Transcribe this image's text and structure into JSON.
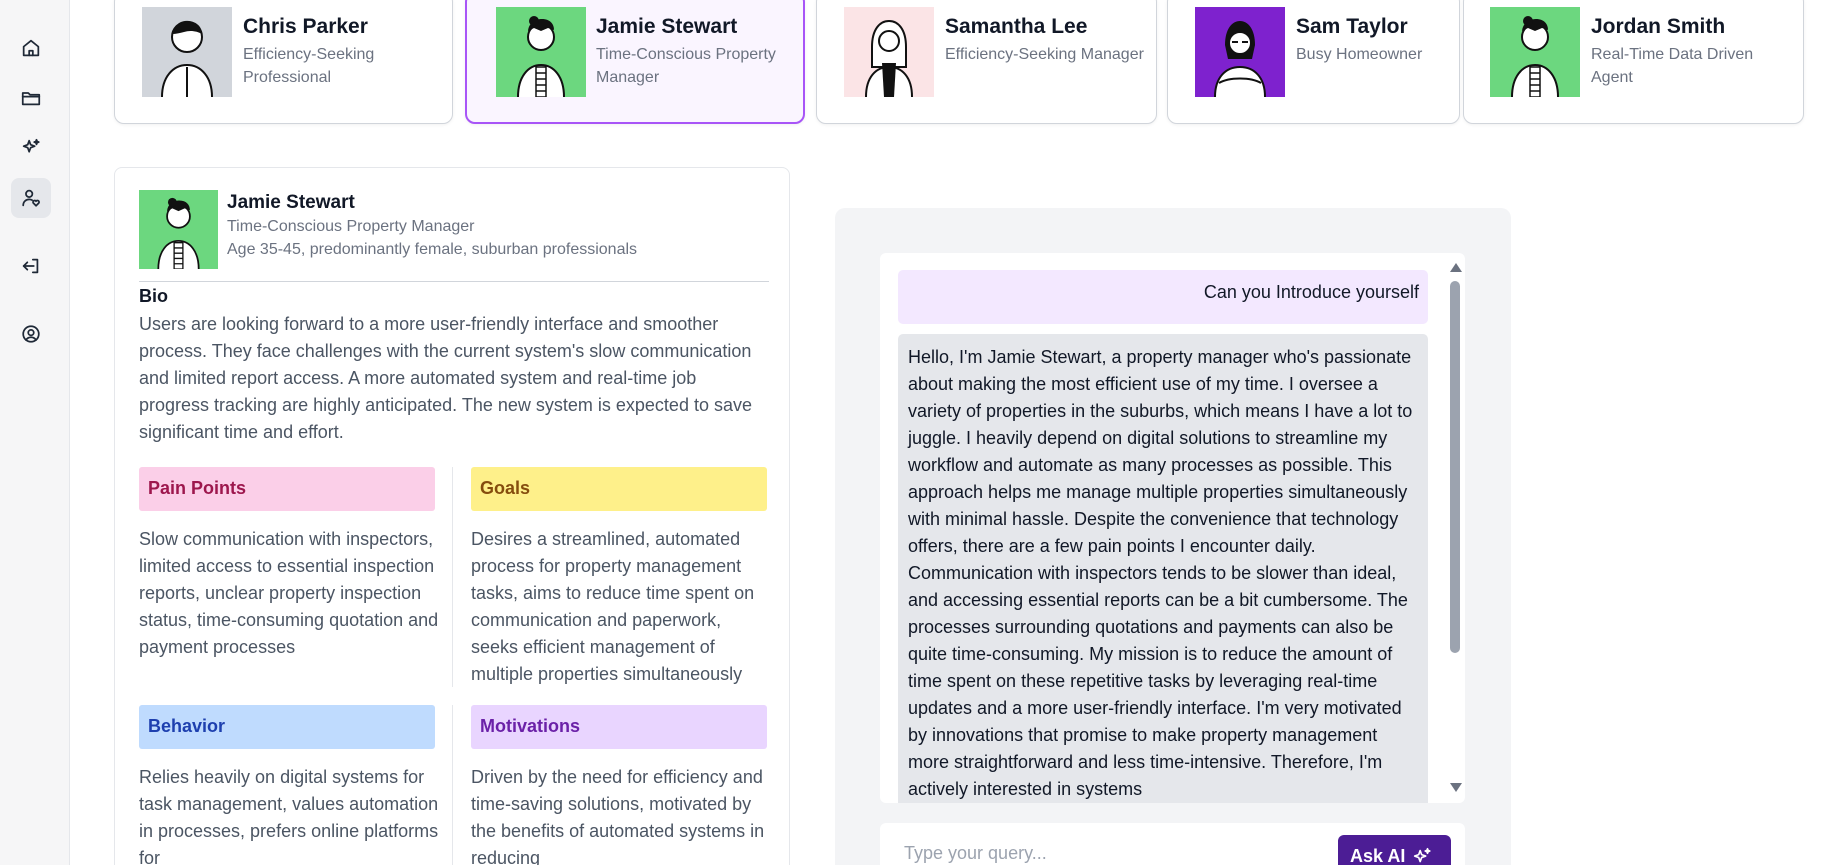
{
  "sidebar": {
    "items": [
      {
        "icon": "home-icon"
      },
      {
        "icon": "folder-icon"
      },
      {
        "icon": "sparkles-icon"
      },
      {
        "icon": "user-heart-icon",
        "active": true
      },
      {
        "icon": "logout-icon"
      },
      {
        "icon": "account-circle-icon"
      }
    ]
  },
  "personas": [
    {
      "name": "Chris Parker",
      "role": "Efficiency-Seeking Professional",
      "avatar_bg": "#d1d5db"
    },
    {
      "name": "Jamie Stewart",
      "role": "Time-Conscious Property Manager",
      "avatar_bg": "#6cd77f",
      "selected": true
    },
    {
      "name": "Samantha Lee",
      "role": "Efficiency-Seeking Manager",
      "avatar_bg": "#fbe4e6"
    },
    {
      "name": "Sam Taylor",
      "role": "Busy Homeowner",
      "avatar_bg": "#7e22ce"
    },
    {
      "name": "Jordan Smith",
      "role": "Real-Time Data Driven Agent",
      "avatar_bg": "#6cd77f"
    }
  ],
  "detail": {
    "name": "Jamie Stewart",
    "role": "Time-Conscious Property Manager",
    "demographic": "Age 35-45, predominantly female, suburban professionals",
    "bio_title": "Bio",
    "bio": "Users are looking forward to a more user-friendly interface and smoother process. They face challenges with the current system's slow communication and limited report access. A more automated system and real-time job progress tracking are highly anticipated. The new system is expected to save significant time and effort.",
    "pain_points": {
      "title": "Pain Points",
      "text": "Slow communication with inspectors, limited access to essential inspection reports, unclear property inspection status, time-consuming quotation and payment processes",
      "bg": "#fbcfe8",
      "color": "#9d174d"
    },
    "goals": {
      "title": "Goals",
      "text": "Desires a streamlined, automated process for property management tasks, aims to reduce time spent on communication and paperwork, seeks efficient management of multiple properties simultaneously",
      "bg": "#fef08a",
      "color": "#854d0e"
    },
    "behavior": {
      "title": "Behavior",
      "text": "Relies heavily on digital systems for task management, values automation in processes, prefers online platforms for",
      "bg": "#bfdbfe",
      "color": "#1e40af"
    },
    "motivations": {
      "title": "Motivations",
      "text": "Driven by the need for efficiency and time-saving solutions, motivated by the benefits of automated systems in reducing",
      "bg": "#e9d5ff",
      "color": "#6b21a8"
    }
  },
  "chat": {
    "user_message": "Can you Introduce yourself",
    "ai_message": "Hello, I'm Jamie Stewart, a property manager who's passionate about making the most efficient use of my time. I oversee a variety of properties in the suburbs, which means I have a lot to juggle. I heavily depend on digital solutions to streamline my workflow and automate as many processes as possible. This approach helps me manage multiple properties simultaneously with minimal hassle. Despite the convenience that technology offers, there are a few pain points I encounter daily. Communication with inspectors tends to be slower than ideal, and accessing essential reports can be a bit cumbersome. The processes surrounding quotations and payments can also be quite time-consuming. My mission is to reduce the amount of time spent on these repetitive tasks by leveraging real-time updates and a more user-friendly interface. I'm very motivated by innovations that promise to make property management more straightforward and less time-intensive. Therefore, I'm actively interested in systems",
    "input_placeholder": "Type your query...",
    "ask_button": "Ask AI"
  }
}
